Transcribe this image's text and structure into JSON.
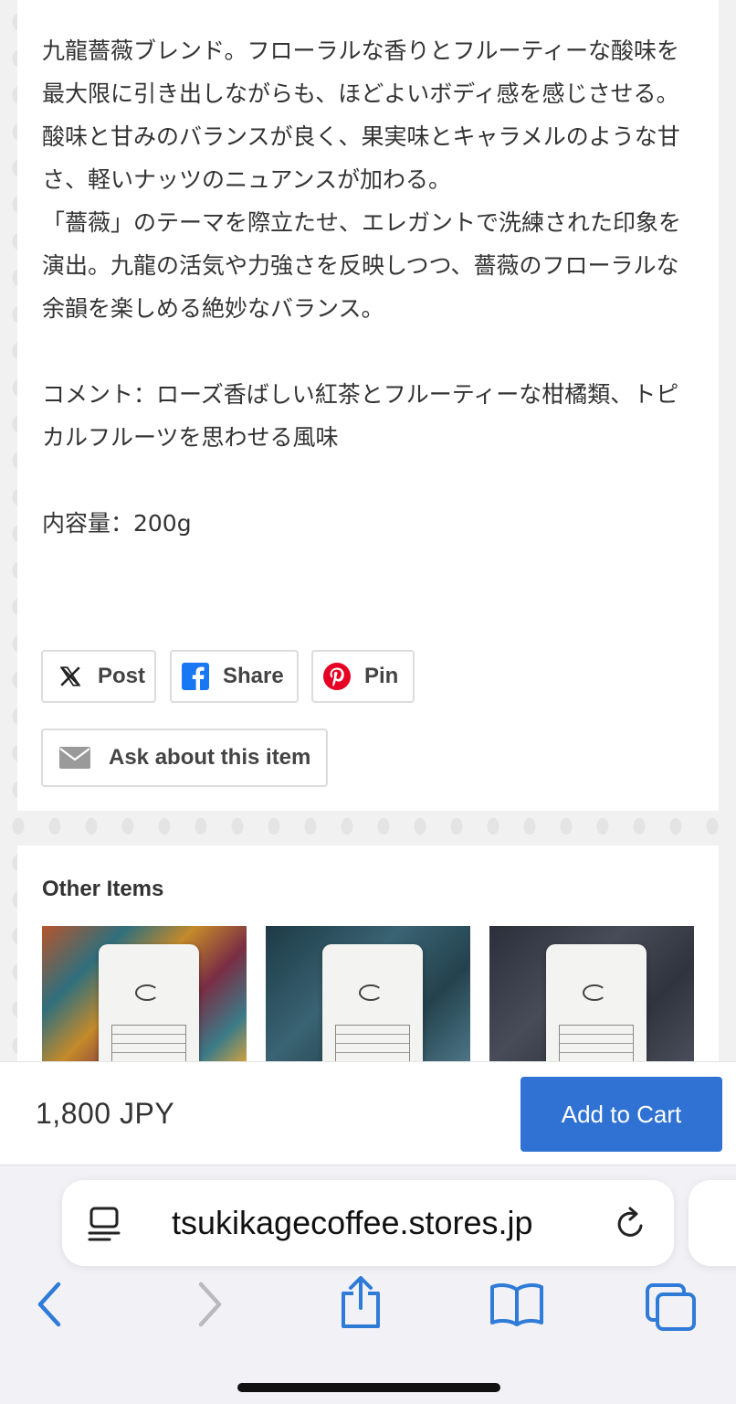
{
  "description": {
    "text": "九龍薔薇ブレンド。フローラルな香りとフルーティーな酸味を最大限に引き出しながらも、ほどよいボディ感を感じさせる。\n酸味と甘みのバランスが良く、果実味とキャラメルのような甘さ、軽いナッツのニュアンスが加わる。\n「薔薇」のテーマを際立たせ、エレガントで洗練された印象を演出。九龍の活気や力強さを反映しつつ、薔薇のフローラルな余韻を楽しめる絶妙なバランス。\n\nコメント：ローズ香ばしい紅茶とフルーティーな柑橘類、トピカルフルーツを思わせる風味\n\n内容量：200g"
  },
  "share": {
    "post_label": "Post",
    "share_label": "Share",
    "pin_label": "Pin",
    "ask_label": "Ask about this item"
  },
  "other_items": {
    "title": "Other Items"
  },
  "cart": {
    "price": "1,800 JPY",
    "add_label": "Add to Cart",
    "accent": "#2f72d3"
  },
  "browser": {
    "url": "tsukikagecoffee.stores.jp",
    "icons": [
      "page-menu-icon",
      "reload-icon",
      "back-icon",
      "forward-icon",
      "share-icon",
      "bookmarks-icon",
      "tabs-icon"
    ]
  }
}
